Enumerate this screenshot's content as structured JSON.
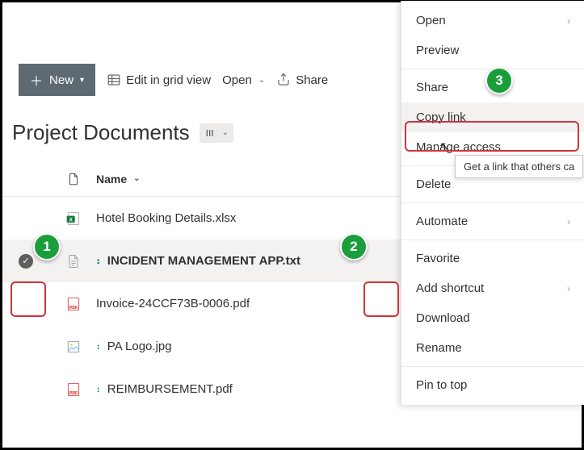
{
  "toolbar": {
    "new_label": "New",
    "edit_label": "Edit in grid view",
    "open_label": "Open",
    "share_label": "Share"
  },
  "page": {
    "title": "Project Documents"
  },
  "columns": {
    "name": "Name"
  },
  "files": [
    {
      "name": "Hotel Booking Details.xlsx",
      "type": "xlsx",
      "new": false,
      "selected": false
    },
    {
      "name": "INCIDENT MANAGEMENT APP.txt",
      "type": "txt",
      "new": true,
      "selected": true
    },
    {
      "name": "Invoice-24CCF73B-0006.pdf",
      "type": "pdf",
      "new": false,
      "selected": false
    },
    {
      "name": "PA Logo.jpg",
      "type": "img",
      "new": true,
      "selected": false
    },
    {
      "name": "REIMBURSEMENT.pdf",
      "type": "pdf",
      "new": true,
      "selected": false
    }
  ],
  "context_menu": {
    "open": "Open",
    "preview": "Preview",
    "share": "Share",
    "copy_link": "Copy link",
    "manage_access": "Manage access",
    "delete": "Delete",
    "automate": "Automate",
    "favorite": "Favorite",
    "add_shortcut": "Add shortcut",
    "download": "Download",
    "rename": "Rename",
    "pin": "Pin to top"
  },
  "tooltip": "Get a link that others ca",
  "callouts": {
    "c1": "1",
    "c2": "2",
    "c3": "3"
  }
}
